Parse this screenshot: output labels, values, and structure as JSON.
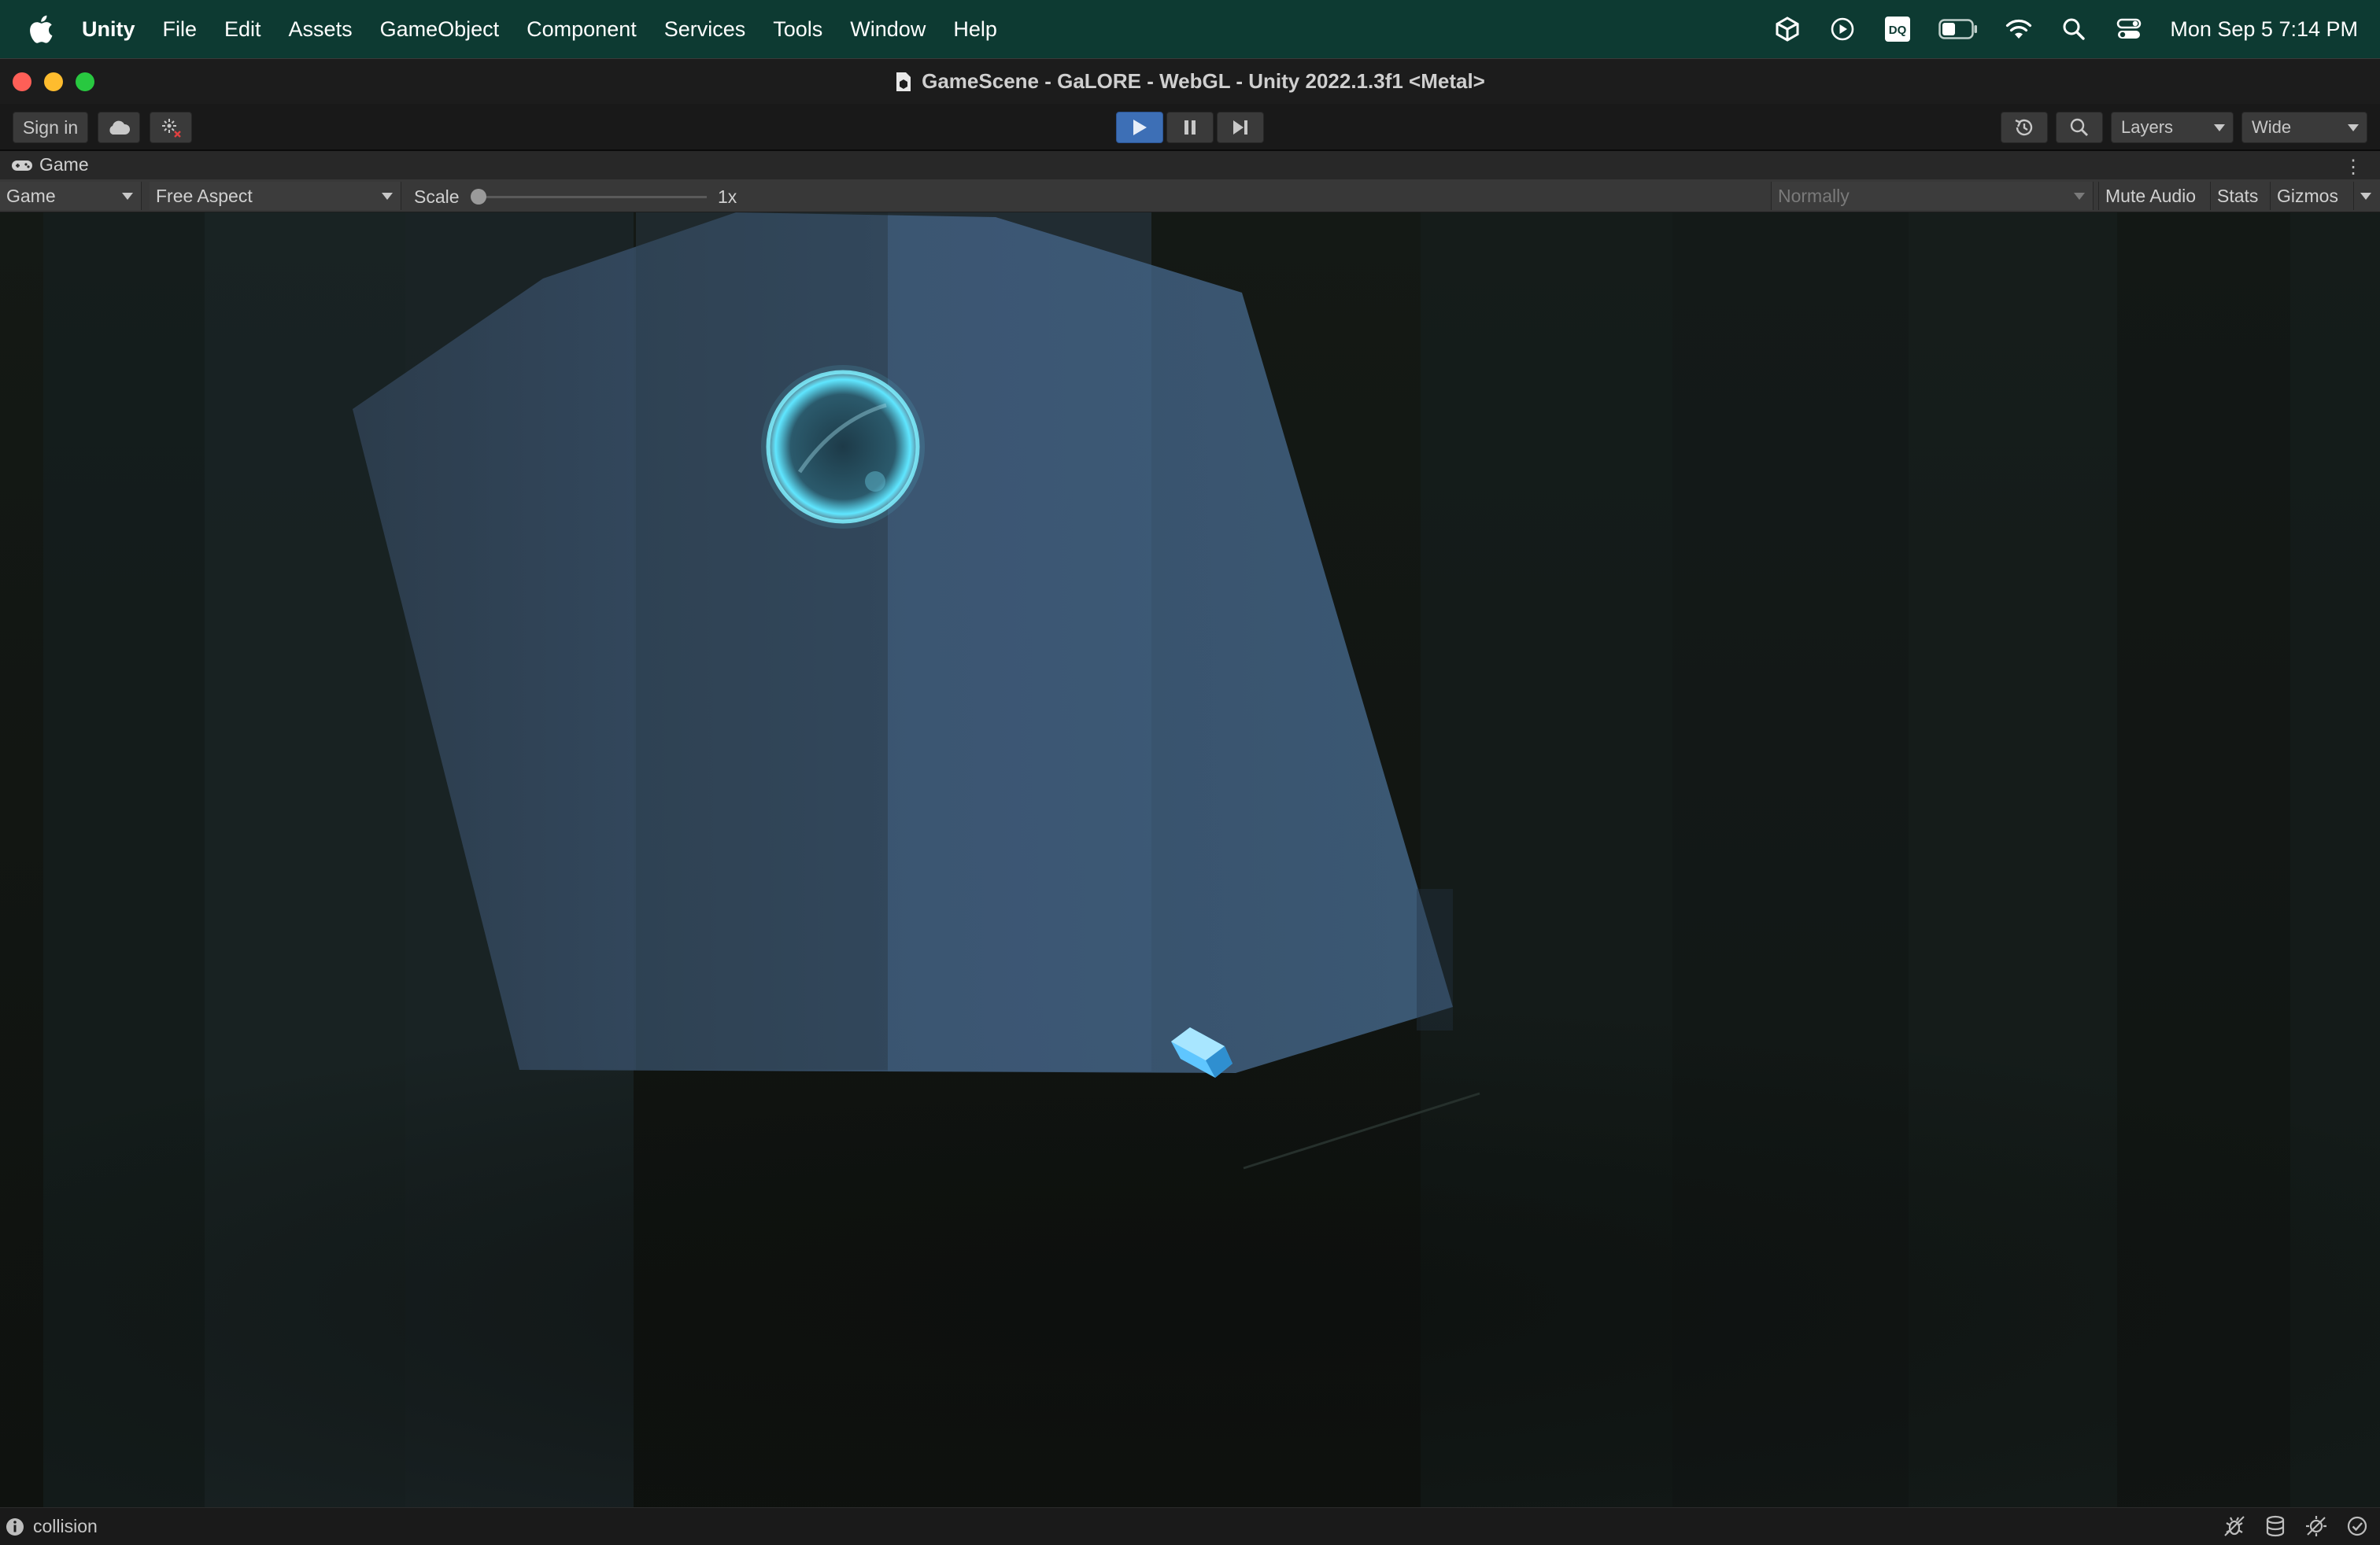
{
  "menubar": {
    "app_name": "Unity",
    "items": [
      "File",
      "Edit",
      "Assets",
      "GameObject",
      "Component",
      "Services",
      "Tools",
      "Window",
      "Help"
    ],
    "status_icons": [
      "unity-hub-icon",
      "play-circle-icon",
      "dq-icon",
      "battery-icon",
      "wifi-icon",
      "search-icon",
      "control-center-icon"
    ],
    "dq_label": "DQ",
    "clock": "Mon Sep 5  7:14 PM"
  },
  "window": {
    "title": "GameScene - GaLORE - WebGL - Unity 2022.1.3f1 <Metal>"
  },
  "toolbar": {
    "sign_in": "Sign in",
    "layers": "Layers",
    "layout": "Wide"
  },
  "game_tab": {
    "label": "Game"
  },
  "game_controls": {
    "display": "Game",
    "aspect": "Free Aspect",
    "scale_label": "Scale",
    "scale_value": "1x",
    "play_mode": "Normally",
    "mute_audio": "Mute Audio",
    "stats": "Stats",
    "gizmos": "Gizmos"
  },
  "status": {
    "message": "collision"
  },
  "colors": {
    "menubar_bg": "#0d3a32",
    "play_active": "#3d6fb6",
    "sphere_glow": "#5fe6ff",
    "panel_blue": "#3e5a78"
  }
}
